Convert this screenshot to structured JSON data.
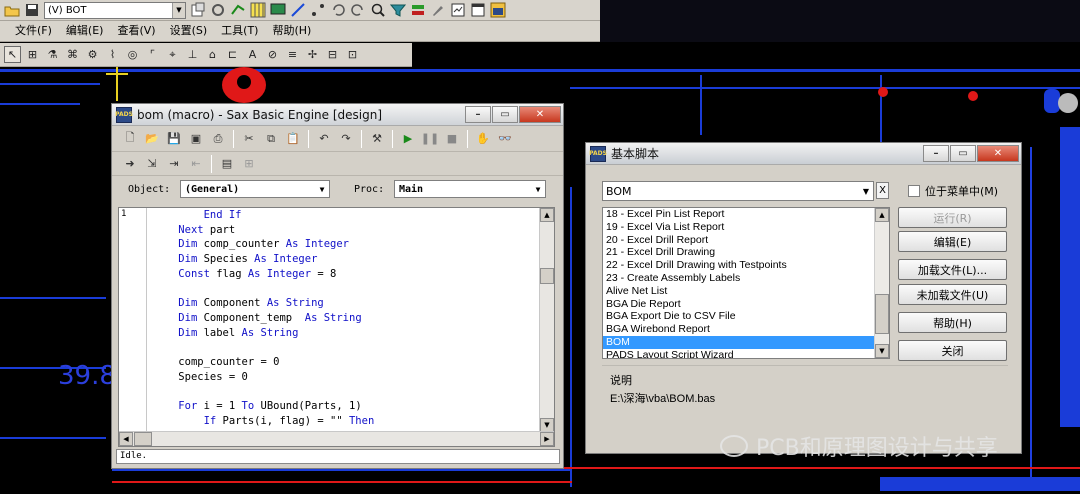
{
  "toolbar": {
    "layer_select": "(V) BOT"
  },
  "menu": {
    "items": [
      "文件(F)",
      "编辑(E)",
      "查看(V)",
      "设置(S)",
      "工具(T)",
      "帮助(H)"
    ]
  },
  "pcb": {
    "dimension_text": "39.8"
  },
  "sax_window": {
    "title": "bom (macro) - Sax Basic Engine [design]",
    "object_label": "Object:",
    "object_value": "(General)",
    "proc_label": "Proc:",
    "proc_value": "Main",
    "line_number": "1",
    "code_lines": [
      {
        "indent": "        ",
        "parts": [
          [
            "kw",
            "End If"
          ]
        ]
      },
      {
        "indent": "    ",
        "parts": [
          [
            "kw",
            "Next "
          ],
          [
            "",
            "part"
          ]
        ]
      },
      {
        "indent": "    ",
        "parts": [
          [
            "kw",
            "Dim "
          ],
          [
            "",
            "comp_counter "
          ],
          [
            "kw",
            "As Integer"
          ]
        ]
      },
      {
        "indent": "    ",
        "parts": [
          [
            "kw",
            "Dim "
          ],
          [
            "",
            "Species "
          ],
          [
            "kw",
            "As Integer"
          ]
        ]
      },
      {
        "indent": "    ",
        "parts": [
          [
            "kw",
            "Const "
          ],
          [
            "",
            "flag "
          ],
          [
            "kw",
            "As Integer"
          ],
          [
            "",
            " = 8"
          ]
        ]
      },
      {
        "indent": "",
        "parts": []
      },
      {
        "indent": "    ",
        "parts": [
          [
            "kw",
            "Dim "
          ],
          [
            "",
            "Component "
          ],
          [
            "kw",
            "As String"
          ]
        ]
      },
      {
        "indent": "    ",
        "parts": [
          [
            "kw",
            "Dim "
          ],
          [
            "",
            "Component_temp  "
          ],
          [
            "kw",
            "As String"
          ]
        ]
      },
      {
        "indent": "    ",
        "parts": [
          [
            "kw",
            "Dim "
          ],
          [
            "",
            "label "
          ],
          [
            "kw",
            "As String"
          ]
        ]
      },
      {
        "indent": "",
        "parts": []
      },
      {
        "indent": "    ",
        "parts": [
          [
            "",
            "comp_counter = 0"
          ]
        ]
      },
      {
        "indent": "    ",
        "parts": [
          [
            "",
            "Species = 0"
          ]
        ]
      },
      {
        "indent": "",
        "parts": []
      },
      {
        "indent": "    ",
        "parts": [
          [
            "kw",
            "For "
          ],
          [
            "",
            "i = 1 "
          ],
          [
            "kw",
            "To "
          ],
          [
            "",
            "UBound(Parts, 1)"
          ]
        ]
      },
      {
        "indent": "        ",
        "parts": [
          [
            "kw",
            "If "
          ],
          [
            "",
            "Parts(i, flag) = \"\" "
          ],
          [
            "kw",
            "Then"
          ]
        ]
      }
    ],
    "status": "Idle."
  },
  "scripts_dialog": {
    "title": "基本脚本",
    "selected_script": "BOM",
    "x_button": "X",
    "show_in_menu_label": "位于菜单中(M)",
    "list_items": [
      "18 - Excel Pin List Report",
      "19 - Excel Via List Report",
      "20 - Excel Drill Report",
      "21 - Excel Drill Drawing",
      "22 - Excel Drill Drawing with Testpoints",
      "23 - Create Assembly Labels",
      "Alive Net List",
      "BGA Die Report",
      "BGA Export Die to CSV File",
      "BGA Wirebond Report",
      "BOM",
      "PADS Layout Script Wizard"
    ],
    "selected_index": 10,
    "buttons": {
      "run": "运行(R)",
      "edit": "编辑(E)",
      "load": "加载文件(L)...",
      "unload": "未加载文件(U)",
      "help": "帮助(H)",
      "close": "关闭"
    },
    "description_label": "说明",
    "description_path": "E:\\深海\\vba\\BOM.bas"
  },
  "watermark": {
    "text": "PCB和原理图设计与共享"
  }
}
